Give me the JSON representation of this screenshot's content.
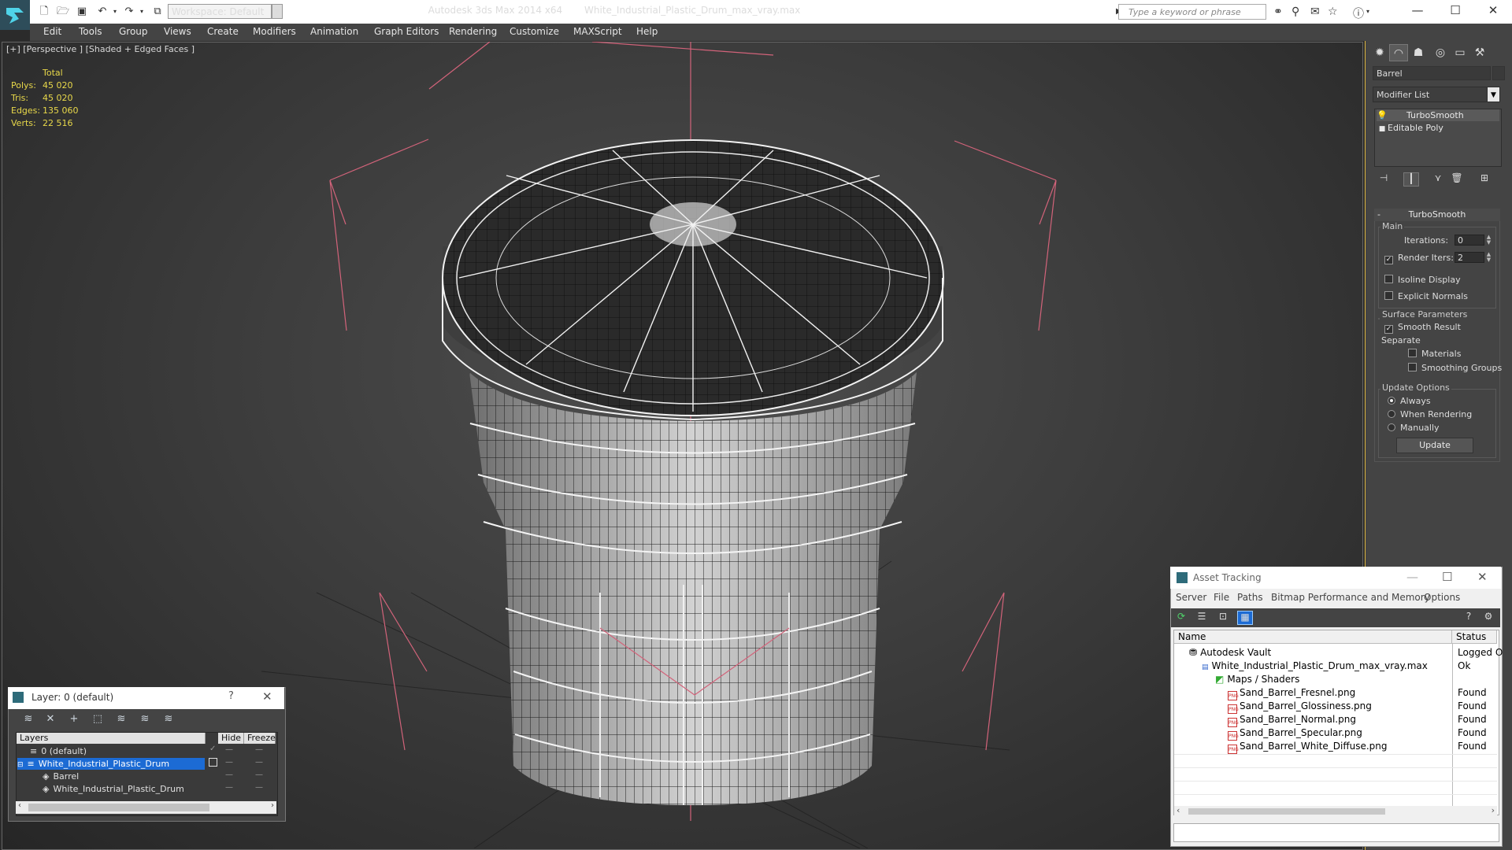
{
  "titlebar": {
    "app_name": "Autodesk 3ds Max  2014 x64",
    "file_name": "White_Industrial_Plastic_Drum_max_vray.max",
    "workspace": "Workspace: Default",
    "search_placeholder": "Type a keyword or phrase"
  },
  "menubar": {
    "items": [
      "Edit",
      "Tools",
      "Group",
      "Views",
      "Create",
      "Modifiers",
      "Animation",
      "Graph Editors",
      "Rendering",
      "Customize",
      "MAXScript",
      "Help"
    ]
  },
  "viewport": {
    "label": "[+] [Perspective ] [Shaded + Edged Faces ]",
    "stats": {
      "header": "Total",
      "polys_label": "Polys:",
      "polys": "45 020",
      "tris_label": "Tris:",
      "tris": "45 020",
      "edges_label": "Edges:",
      "edges": "135 060",
      "verts_label": "Verts:",
      "verts": "22 516"
    }
  },
  "command_panel": {
    "object_name": "Barrel",
    "modifier_list": "Modifier List",
    "stack": [
      "TurboSmooth",
      "Editable Poly"
    ],
    "rollout_title": "TurboSmooth",
    "main_group": "Main",
    "iterations_label": "Iterations:",
    "iterations_value": "0",
    "render_iters_label": "Render Iters:",
    "render_iters_value": "2",
    "isoline_display": "Isoline Display",
    "explicit_normals": "Explicit Normals",
    "surface_group": "Surface Parameters",
    "smooth_result": "Smooth Result",
    "separate_label": "Separate",
    "materials": "Materials",
    "smoothing_groups": "Smoothing Groups",
    "update_group": "Update Options",
    "always": "Always",
    "when_rendering": "When Rendering",
    "manually": "Manually",
    "update_button": "Update"
  },
  "layer_dialog": {
    "title": "Layer: 0 (default)",
    "help": "?",
    "columns": [
      "Layers",
      "Hide",
      "Freeze"
    ],
    "rows": [
      "0 (default)",
      "White_Industrial_Plastic_Drum",
      "Barrel",
      "White_Industrial_Plastic_Drum"
    ]
  },
  "asset_tracking": {
    "title": "Asset Tracking",
    "menu": [
      "Server",
      "File",
      "Paths",
      "Bitmap Performance and Memory",
      "Options"
    ],
    "columns": [
      "Name",
      "Status"
    ],
    "rows": [
      {
        "name": "Autodesk Vault",
        "status": "Logged O"
      },
      {
        "name": "White_Industrial_Plastic_Drum_max_vray.max",
        "status": "Ok"
      },
      {
        "name": "Maps / Shaders",
        "status": ""
      },
      {
        "name": "Sand_Barrel_Fresnel.png",
        "status": "Found"
      },
      {
        "name": "Sand_Barrel_Glossiness.png",
        "status": "Found"
      },
      {
        "name": "Sand_Barrel_Normal.png",
        "status": "Found"
      },
      {
        "name": "Sand_Barrel_Specular.png",
        "status": "Found"
      },
      {
        "name": "Sand_Barrel_White_Diffuse.png",
        "status": "Found"
      }
    ],
    "png_badge": "PNG"
  },
  "colors": {
    "selection": "#1c6bd4",
    "stats_text": "#e8d84a",
    "panel_accent": "#e0b840",
    "bounding_box": "#d2637a"
  },
  "icons": [
    "app-logo-icon",
    "new-file-icon",
    "open-icon",
    "save-icon",
    "undo-icon",
    "redo-icon",
    "binoculars-icon",
    "search-icon",
    "star-icon",
    "help-icon",
    "minimize-icon",
    "maximize-icon",
    "close-icon"
  ]
}
